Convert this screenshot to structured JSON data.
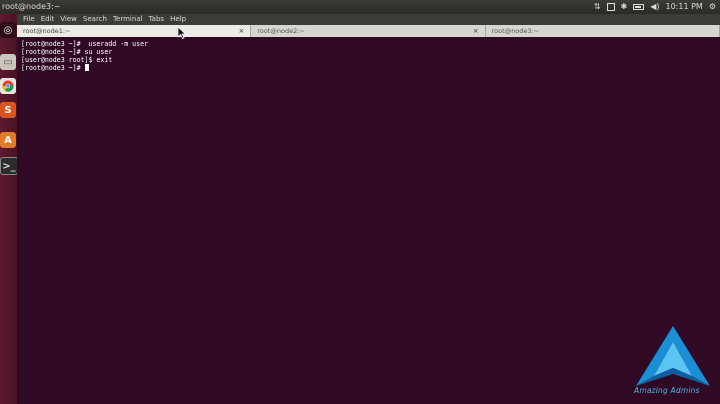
{
  "window": {
    "title": "root@node3:~",
    "clock": "10:11 PM"
  },
  "menu": {
    "items": [
      "File",
      "Edit",
      "View",
      "Search",
      "Terminal",
      "Tabs",
      "Help"
    ]
  },
  "tabs": [
    {
      "label": "root@node1:~",
      "active": true
    },
    {
      "label": "root@node2:~",
      "active": false
    },
    {
      "label": "root@node3:~",
      "active": false
    }
  ],
  "terminal": {
    "lines": [
      "[root@node3 ~]#  useradd -m user",
      "[root@node3 ~]# su user",
      "[user@node3 root]$ exit",
      "[root@node3 ~]# "
    ],
    "background_color": "#300a24",
    "text_color": "#ffffff"
  },
  "launcher": {
    "icons": [
      "ubuntu-dash-icon",
      "files-icon",
      "chrome-icon",
      "libreoffice-impress-icon",
      "software-center-icon",
      "terminal-icon"
    ]
  },
  "watermark": {
    "text": "Amazing Admins",
    "color": "#4fb6e8"
  }
}
